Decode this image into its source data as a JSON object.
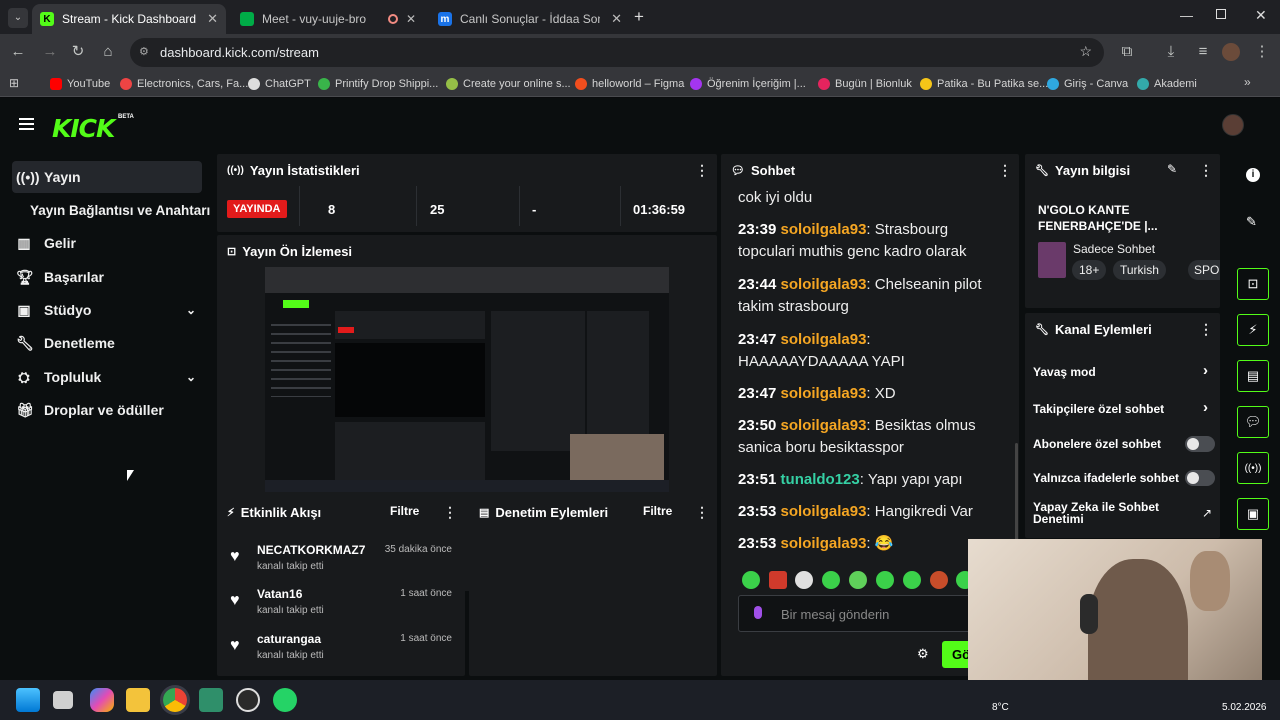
{
  "browser": {
    "tabs": [
      {
        "title": "Stream - Kick Dashboard",
        "active": true,
        "icon": "kick-icon",
        "color": "#53fc18"
      },
      {
        "title": "Meet - vuy-uuje-bro",
        "active": false,
        "icon": "meet-icon",
        "color": "#00ac47"
      },
      {
        "title": "Canlı Sonuçlar - İddaa Sonuçlar",
        "active": false,
        "icon": "m-icon",
        "color": "#1a73e8"
      }
    ],
    "url": "dashboard.kick.com/stream",
    "bookmarks": [
      "YouTube",
      "Electronics, Cars, Fa...",
      "ChatGPT",
      "Printify Drop Shippi...",
      "Create your online s...",
      "helloworld – Figma",
      "Öğrenim İçeriğim |...",
      "Bugün | Bionluk",
      "Patika - Bu Patika se...",
      "Giriş - Canva",
      "Akademi"
    ]
  },
  "app": {
    "logo": "KICK",
    "beta": "BETA",
    "accent": "#53fc18",
    "nav": [
      {
        "label": "Yayın",
        "icon": "broadcast-icon",
        "active": true
      },
      {
        "label": "Yayın Bağlantısı ve Anahtarı",
        "icon": "",
        "active": false
      },
      {
        "label": "Gelir",
        "icon": "chart-icon",
        "active": false
      },
      {
        "label": "Başarılar",
        "icon": "trophy-icon",
        "active": false
      },
      {
        "label": "Stüdyo",
        "icon": "studio-icon",
        "active": false,
        "expandable": true
      },
      {
        "label": "Denetleme",
        "icon": "wrench-icon",
        "active": false
      },
      {
        "label": "Topluluk",
        "icon": "community-icon",
        "active": false,
        "expandable": true
      },
      {
        "label": "Droplar ve ödüller",
        "icon": "gift-icon",
        "active": false
      }
    ]
  },
  "stats": {
    "title": "Yayın İstatistikleri",
    "status": "YAYINDA",
    "values": [
      "8",
      "25",
      "-",
      "01:36:59"
    ]
  },
  "preview": {
    "title": "Yayın Ön İzlemesi"
  },
  "activity": {
    "title": "Etkinlik Akışı",
    "filter": "Filtre",
    "items": [
      {
        "name": "NECATKORKMAZ7",
        "time": "35 dakika önce",
        "action": "kanalı takip etti"
      },
      {
        "name": "Vatan16",
        "time": "1 saat önce",
        "action": "kanalı takip etti"
      },
      {
        "name": "caturangaa",
        "time": "1 saat önce",
        "action": "kanalı takip etti"
      }
    ]
  },
  "moderation": {
    "title": "Denetim Eylemleri",
    "filter": "Filtre"
  },
  "chat": {
    "title": "Sohbet",
    "lead": "cok iyi oldu",
    "messages": [
      {
        "time": "23:39",
        "user": "soloilgala93",
        "color": "#f5a623",
        "text": "Strasbourg topculari muthis genc kadro olarak"
      },
      {
        "time": "23:44",
        "user": "soloilgala93",
        "color": "#f5a623",
        "text": "Chelseanin pilot takim strasbourg"
      },
      {
        "time": "23:47",
        "user": "soloilgala93",
        "color": "#f5a623",
        "text": "HAAAAAYDAAAAA YAPI"
      },
      {
        "time": "23:47",
        "user": "soloilgala93",
        "color": "#f5a623",
        "text": "XD"
      },
      {
        "time": "23:50",
        "user": "soloilgala93",
        "color": "#f5a623",
        "text": "Besiktas olmus sanica boru besiktasspor"
      },
      {
        "time": "23:51",
        "user": "tunaldo123",
        "color": "#35d0a4",
        "text": "Yapı yapı yapı"
      },
      {
        "time": "23:53",
        "user": "soloilgala93",
        "color": "#f5a623",
        "text": "Hangikredi Var"
      },
      {
        "time": "23:53",
        "user": "soloilgala93",
        "color": "#f5a623",
        "text": "😂"
      }
    ],
    "placeholder": "Bir mesaj gönderin",
    "send": "Gö"
  },
  "info": {
    "title": "Yayın bilgisi",
    "stream_title": "N'GOLO KANTE FENERBAHÇE'DE |...",
    "category": "Sadece Sohbet",
    "tags": [
      "18+",
      "Turkish",
      "SPOR"
    ]
  },
  "channel_actions": {
    "title": "Kanal Eylemleri",
    "items": [
      {
        "label": "Yavaş mod",
        "type": "arrow"
      },
      {
        "label": "Takipçilere özel sohbet",
        "type": "arrow"
      },
      {
        "label": "Abonelere özel sohbet",
        "type": "toggle"
      },
      {
        "label": "Yalnızca ifadelerle sohbet",
        "type": "toggle"
      },
      {
        "label": "Yapay Zeka ile Sohbet Denetimi",
        "type": "external"
      }
    ]
  },
  "taskbar": {
    "weather": "8°C",
    "date": "5.02.2026"
  }
}
